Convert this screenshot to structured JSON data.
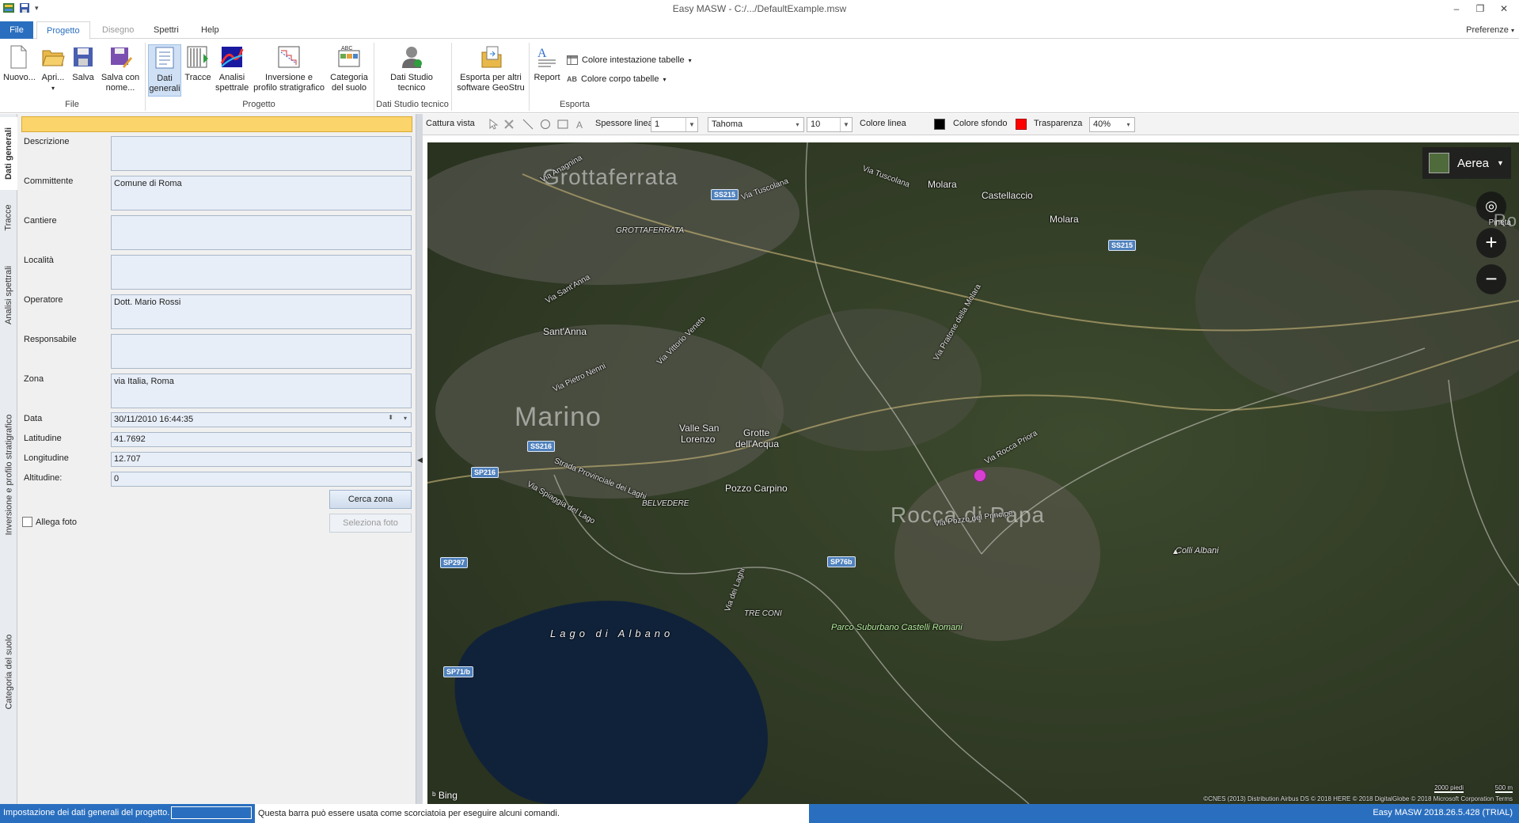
{
  "window": {
    "title": "Easy MASW - C:/.../DefaultExample.msw",
    "minimize": "–",
    "restore": "❐",
    "close": "✕"
  },
  "tabs": {
    "file": "File",
    "progetto": "Progetto",
    "disegno": "Disegno",
    "spettri": "Spettri",
    "help": "Help",
    "preferences": "Preferenze"
  },
  "ribbon": {
    "file_group": "File",
    "progetto_group": "Progetto",
    "studio_group": "Dati Studio tecnico",
    "esporta_group": "Esporta",
    "nuovo": "Nuovo...",
    "apri": "Apri...",
    "salva": "Salva",
    "salva_con_nome_1": "Salva con",
    "salva_con_nome_2": "nome...",
    "dati_generali_1": "Dati",
    "dati_generali_2": "generali",
    "tracce": "Tracce",
    "analisi_1": "Analisi",
    "analisi_2": "spettrale",
    "inversione_1": "Inversione e",
    "inversione_2": "profilo stratigrafico",
    "categoria_1": "Categoria",
    "categoria_2": "del suolo",
    "studio_1": "Dati Studio",
    "studio_2": "tecnico",
    "esporta_1": "Esporta per altri",
    "esporta_2": "software GeoStru",
    "report": "Report",
    "colore_intestazione": "Colore intestazione tabelle",
    "colore_corpo": "Colore corpo tabelle"
  },
  "vtabs": {
    "dati_generali": "Dati generali",
    "tracce": "Tracce",
    "analisi": "Analisi spettrali",
    "inversione": "Inversione e profilo stratigrafico",
    "categoria": "Categoria del suolo"
  },
  "form": {
    "descrizione_label": "Descrizione",
    "descrizione_value": "",
    "committente_label": "Committente",
    "committente_value": "Comune di Roma",
    "cantiere_label": "Cantiere",
    "cantiere_value": "",
    "localita_label": "Località",
    "localita_value": "",
    "operatore_label": "Operatore",
    "operatore_value": "Dott. Mario Rossi",
    "responsabile_label": "Responsabile",
    "responsabile_value": "",
    "zona_label": "Zona",
    "zona_value": "via Italia, Roma",
    "data_label": "Data",
    "data_value": "30/11/2010 16:44:35",
    "latitudine_label": "Latitudine",
    "latitudine_value": "41.7692",
    "longitudine_label": "Longitudine",
    "longitudine_value": "12.707",
    "altitudine_label": "Altitudine:",
    "altitudine_value": "0",
    "cerca_zona": "Cerca zona",
    "seleziona_foto": "Seleziona foto",
    "allega_foto": "Allega foto"
  },
  "maptoolbar": {
    "cattura_vista": "Cattura vista",
    "spessore_linea": "Spessore linea",
    "spessore_value": "1",
    "font_value": "Tahoma",
    "size_value": "10",
    "colore_linea": "Colore linea",
    "colore_linea_hex": "#000000",
    "colore_sfondo": "Colore sfondo",
    "colore_sfondo_hex": "#ff0000",
    "trasparenza": "Trasparenza",
    "trasparenza_value": "40%"
  },
  "map": {
    "view_mode": "Aerea",
    "pinetta": "Pineta",
    "roma_fragment": "Ro",
    "labels": {
      "grottaferrata_big": "Grottaferrata",
      "grottaferrata_small": "GROTTAFERRATA",
      "marino": "Marino",
      "rocca": "Rocca di Papa",
      "molara1": "Molara",
      "molara2": "Molara",
      "castellaccio": "Castellaccio",
      "santanna": "Sant'Anna",
      "valle_san_lorenzo_1": "Valle San",
      "valle_san_lorenzo_2": "Lorenzo",
      "grotte_1": "Grotte",
      "grotte_2": "dell'Acqua",
      "pozzo": "Pozzo Carpino",
      "belvedere": "BELVEDERE",
      "lago": "Lago di Albano",
      "parco": "Parco Suburbano Castelli Romani",
      "colli": "Colli Albani",
      "treconi": "TRE CONI",
      "via_anagnina": "Via Anagnina",
      "via_tuscolana": "Via Tuscolana",
      "via_tuscolana2": "Via Tuscolana",
      "via_sant_anna": "Via Sant'Anna",
      "via_pietro_nenni": "Via Pietro Nenni",
      "via_vittorio": "Via Vittorio Veneto",
      "via_laghi": "Via dei Laghi",
      "strada_provinciale": "Strada Provinciale dei Laghi",
      "via_spiaggia": "Via Spiaggia del Lago",
      "via_rocca_priora": "Via Rocca Priora",
      "via_pozzo_principe": "Via Pozzo del Principe",
      "via_pratone": "Via Pratone della Molara"
    },
    "shields": {
      "ss215_a": "SS215",
      "ss215_b": "SS215",
      "ss216": "SS216",
      "sp216": "SP216",
      "sp297": "SP297",
      "sp76b": "SP76b",
      "sp71b": "SP71/b"
    },
    "bing": "Bing",
    "scale_a": "2000 piedi",
    "scale_b": "500 m",
    "copyright": "©CNES (2013) Distribution Airbus DS © 2018 HERE © 2018 DigitalGlobe © 2018 Microsoft Corporation Terms"
  },
  "status": {
    "left": "Impostazione dei dati generali del progetto.",
    "hint": "Questa barra può essere usata come scorciatoia per eseguire alcuni comandi.",
    "right": "Easy MASW 2018.26.5.428 (TRIAL)"
  }
}
